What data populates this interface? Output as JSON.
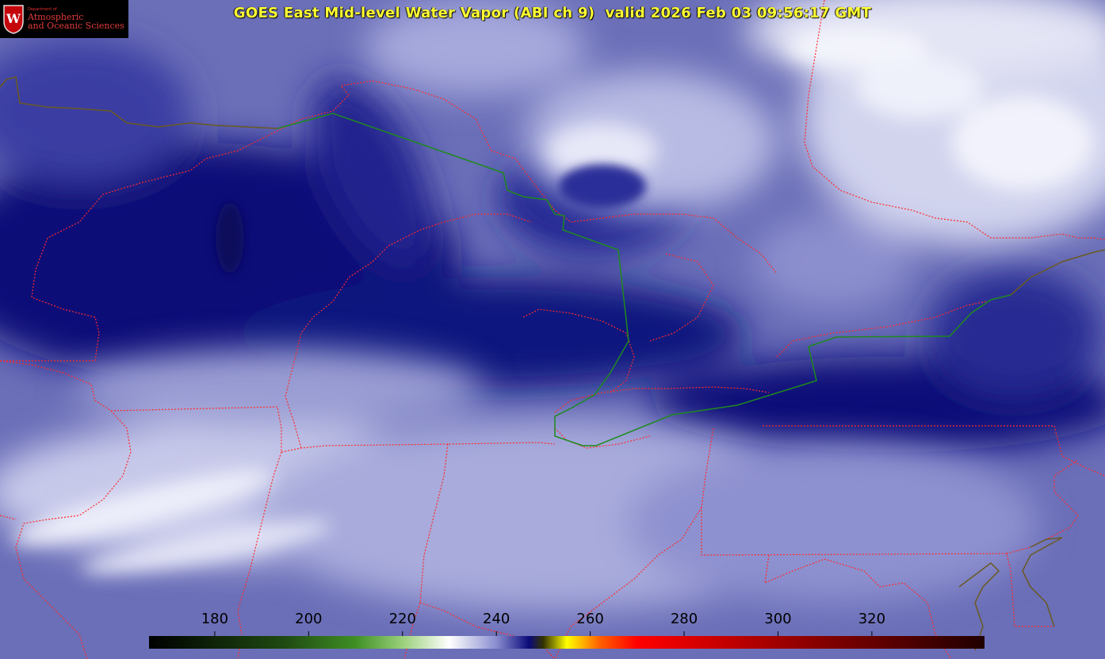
{
  "title": "GOES East Mid-level Water Vapor (ABI ch 9)  valid 2026 Feb 03 09:56:17 GMT",
  "logo": {
    "dept": "Department of",
    "line1": "Atmospheric",
    "line2": "and Oceanic Sciences",
    "crest": "W"
  },
  "colorbar": {
    "ticks": [
      "180",
      "200",
      "220",
      "240",
      "260",
      "280",
      "300",
      "320"
    ],
    "tick_values": [
      180,
      200,
      220,
      240,
      260,
      280,
      300,
      320
    ],
    "range": [
      166,
      344
    ],
    "stops": [
      {
        "v": 166,
        "c": "#000000"
      },
      {
        "v": 195,
        "c": "#1f4a12"
      },
      {
        "v": 210,
        "c": "#3f8f25"
      },
      {
        "v": 220,
        "c": "#9ad07a"
      },
      {
        "v": 230,
        "c": "#ffffff"
      },
      {
        "v": 240,
        "c": "#8a8ed0"
      },
      {
        "v": 247,
        "c": "#0a0a7a"
      },
      {
        "v": 250,
        "c": "#333300"
      },
      {
        "v": 255,
        "c": "#ffff00"
      },
      {
        "v": 262,
        "c": "#ff6000"
      },
      {
        "v": 270,
        "c": "#ff0000"
      },
      {
        "v": 300,
        "c": "#a00000"
      },
      {
        "v": 344,
        "c": "#200000"
      }
    ]
  },
  "colors": {
    "state_borders": "#ff2a2a",
    "international_border": "#1e8a1e",
    "title_text": "#ffff33"
  }
}
